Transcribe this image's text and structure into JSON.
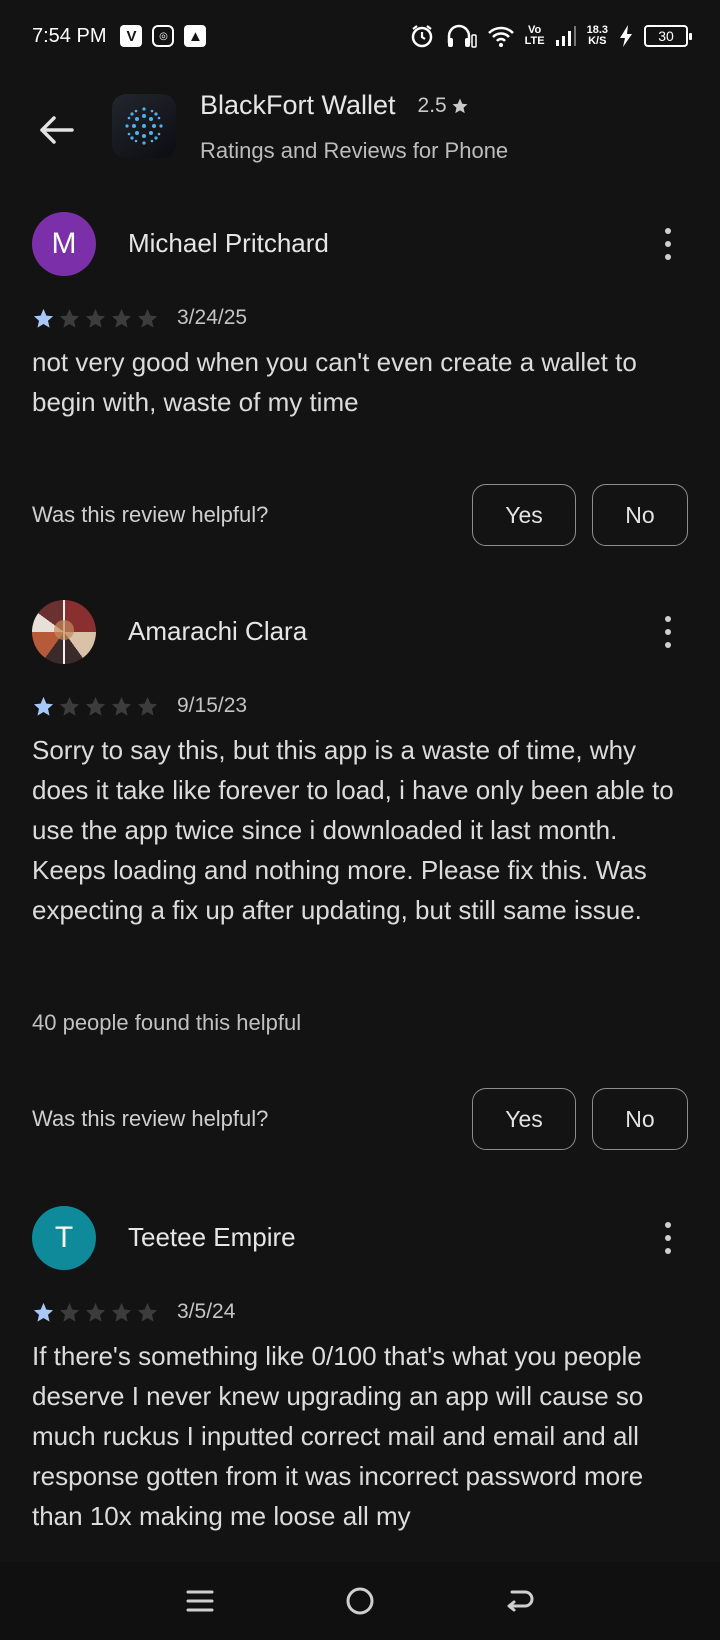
{
  "status_bar": {
    "time": "7:54 PM",
    "net_speed_value": "18.3",
    "net_speed_unit": "K/S",
    "network_label_top": "Vo",
    "network_label_bottom": "LTE",
    "battery": "30"
  },
  "header": {
    "app_name": "BlackFort Wallet",
    "rating": "2.5",
    "subtitle": "Ratings and Reviews for Phone"
  },
  "reviews": [
    {
      "avatar_letter": "M",
      "avatar_color": "#7b2fa8",
      "author": "Michael Pritchard",
      "stars": 1,
      "date": "3/24/25",
      "text": "not very good when you can't even create a wallet to begin with, waste of my time",
      "helpful_count": "",
      "helpful_question": "Was this review helpful?",
      "yes_label": "Yes",
      "no_label": "No"
    },
    {
      "avatar_letter": "",
      "avatar_color": "#5a2b2b",
      "author": "Amarachi Clara",
      "stars": 1,
      "date": "9/15/23",
      "text": "Sorry to say this, but this app is a waste of time, why does it take like forever to load, i have only been able to use the app twice since i downloaded it last month. Keeps loading and nothing more. Please fix this. Was expecting a fix up after updating, but still same issue.",
      "helpful_count": "40 people found this helpful",
      "helpful_question": "Was this review helpful?",
      "yes_label": "Yes",
      "no_label": "No"
    },
    {
      "avatar_letter": "T",
      "avatar_color": "#0e8a9a",
      "author": "Teetee Empire",
      "stars": 1,
      "date": "3/5/24",
      "text": "If there's something like 0/100 that's what you people deserve I never knew upgrading an app will cause so much ruckus I inputted correct mail and email and all response gotten from it was incorrect password more than 10x making me loose all my",
      "helpful_count": "",
      "helpful_question": "",
      "yes_label": "",
      "no_label": ""
    }
  ],
  "colors": {
    "background": "#131313",
    "star_filled": "#a8c7fa",
    "star_empty": "#3c3c3c"
  },
  "nav_bar": {
    "icons": [
      "menu-icon",
      "home-circle-icon",
      "back-arrow-icon"
    ]
  }
}
